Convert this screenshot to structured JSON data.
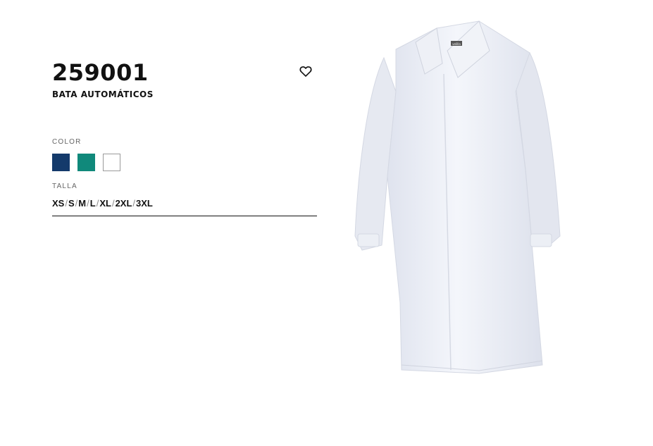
{
  "product": {
    "code": "259001",
    "name": "BATA AUTOMÁTICOS",
    "favorite_icon": "heart-outline-icon"
  },
  "color": {
    "label": "COLOR",
    "swatches": [
      {
        "color": "#143a6b",
        "border": "#143a6b"
      },
      {
        "color": "#10897b",
        "border": "#10897b"
      },
      {
        "color": "#ffffff",
        "border": "#9a9a9a"
      }
    ]
  },
  "size": {
    "label": "TALLA",
    "options": [
      "XS",
      "S",
      "M",
      "L",
      "XL",
      "2XL",
      "3XL"
    ],
    "separator": "/"
  },
  "image": {
    "brand_tag": "velilla"
  }
}
